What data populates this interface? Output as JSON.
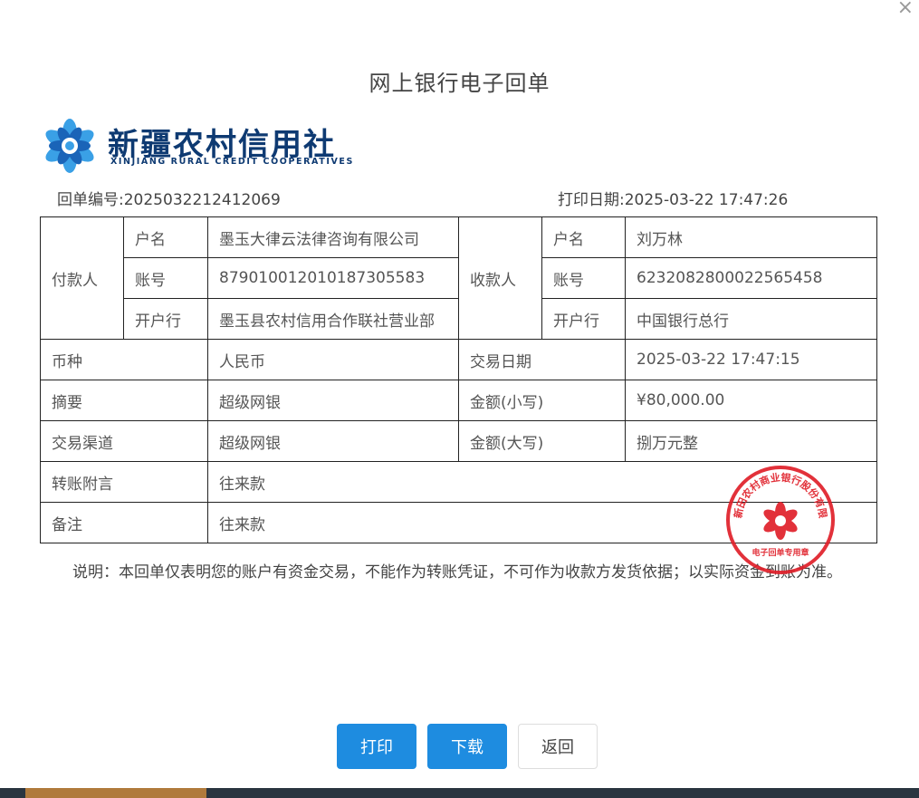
{
  "dialog": {
    "title": "网上银行电子回单",
    "close_label": "×"
  },
  "logo": {
    "name_cn": "新疆农村信用社",
    "name_en": "XINJIANG RURAL CREDIT COOPERATIVES"
  },
  "receipt": {
    "number_label": "回单编号:",
    "number": "2025032212412069",
    "print_date_label": "打印日期:",
    "print_date": "2025-03-22 17:47:26"
  },
  "table": {
    "payer_label": "付款人",
    "payee_label": "收款人",
    "name_label": "户名",
    "account_label": "账号",
    "bank_label": "开户行",
    "payer": {
      "name": "墨玉大律云法律咨询有限公司",
      "account": "879010012010187305583",
      "bank": "墨玉县农村信用合作联社营业部"
    },
    "payee": {
      "name": "刘万林",
      "account": "6232082800022565458",
      "bank": "中国银行总行"
    },
    "currency_label": "币种",
    "currency": "人民币",
    "trade_date_label": "交易日期",
    "trade_date": "2025-03-22 17:47:15",
    "summary_label": "摘要",
    "summary": "超级网银",
    "amount_small_label": "金额(小写)",
    "amount_small": "¥80,000.00",
    "channel_label": "交易渠道",
    "channel": "超级网银",
    "amount_big_label": "金额(大写)",
    "amount_big": "捌万元整",
    "memo_label": "转账附言",
    "memo": "往来款",
    "remark_label": "备注",
    "remark": "往来款"
  },
  "note": "说明：本回单仅表明您的账户有资金交易，不能作为转账凭证，不可作为收款方发货依据；以实际资金到账为准。",
  "seal": {
    "top_text": "新疆新田农村商业银行股份有限公司",
    "bottom_text": "电子回单专用章",
    "color": "#e0202a"
  },
  "buttons": {
    "print": "打印",
    "download": "下载",
    "back": "返回"
  },
  "colors": {
    "primary": "#1e8ce0",
    "brand": "#0e3a72",
    "seal": "#e0202a"
  }
}
